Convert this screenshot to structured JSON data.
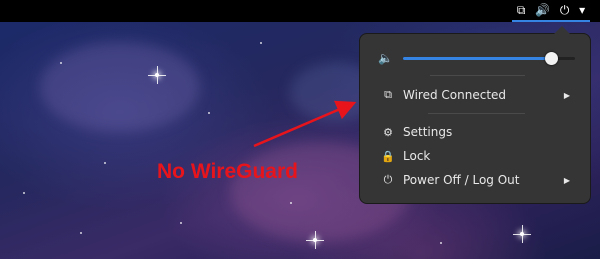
{
  "topbar": {
    "icons": [
      {
        "name": "network-wired-icon",
        "glyph": "⧉"
      },
      {
        "name": "volume-icon",
        "glyph": "🔊"
      },
      {
        "name": "power-icon",
        "glyph": "⏻"
      },
      {
        "name": "dropdown-arrow-icon",
        "glyph": "▾"
      }
    ],
    "accent_color": "#3584e4"
  },
  "menu": {
    "volume": {
      "icon": "🔈",
      "level": 0.86
    },
    "items": [
      {
        "label": "Wired Connected",
        "icon": "⧉",
        "submenu": true
      },
      {
        "label": "Settings",
        "icon": "⚙",
        "submenu": false
      },
      {
        "label": "Lock",
        "icon": "🔒",
        "submenu": false
      },
      {
        "label": "Power Off / Log Out",
        "icon": "⏻",
        "submenu": true
      }
    ],
    "submenu_arrow": "▶"
  },
  "annotation": {
    "text": "No WireGuard",
    "color": "#e8141c"
  }
}
